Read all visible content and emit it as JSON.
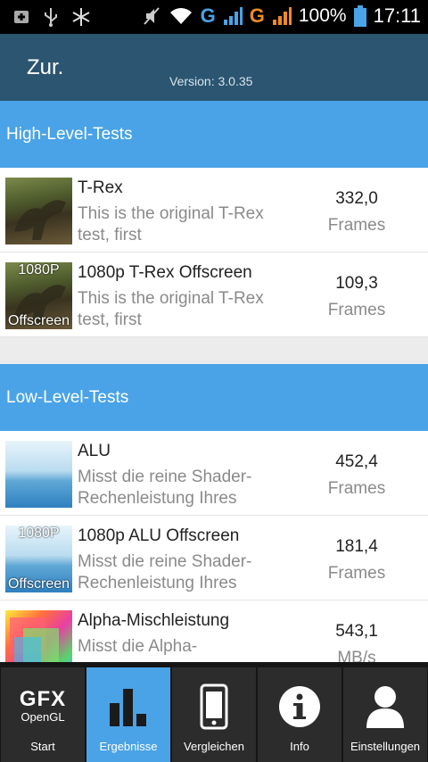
{
  "status_bar": {
    "battery": "100%",
    "time": "17:11",
    "network_1": "G",
    "network_2": "G",
    "icons": [
      "notification-icon",
      "usb-icon",
      "snowflake-icon",
      "mute-icon",
      "wifi-icon",
      "signal-icon",
      "signal-icon",
      "battery-icon"
    ]
  },
  "header": {
    "back_label": "Zur.",
    "version": "Version: 3.0.35"
  },
  "sections": [
    {
      "title": "High-Level-Tests",
      "items": [
        {
          "title": "T-Rex",
          "desc": "This is the original T-Rex test, first",
          "value": "332,0",
          "unit": "Frames",
          "thumb": "trex",
          "overlay_top": "",
          "overlay_bottom": ""
        },
        {
          "title": "1080p T-Rex Offscreen",
          "desc": "This is the original T-Rex test, first",
          "value": "109,3",
          "unit": "Frames",
          "thumb": "trex",
          "overlay_top": "1080P",
          "overlay_bottom": "Offscreen"
        }
      ]
    },
    {
      "title": "Low-Level-Tests",
      "items": [
        {
          "title": "ALU",
          "desc": "Misst die reine Shader-Rechenleistung Ihres",
          "value": "452,4",
          "unit": "Frames",
          "thumb": "alu",
          "overlay_top": "",
          "overlay_bottom": ""
        },
        {
          "title": "1080p ALU Offscreen",
          "desc": "Misst die reine Shader-Rechenleistung Ihres",
          "value": "181,4",
          "unit": "Frames",
          "thumb": "alu",
          "overlay_top": "1080P",
          "overlay_bottom": "Offscreen"
        },
        {
          "title": "Alpha-Mischleistung",
          "desc": "Misst die Alpha-",
          "value": "543,1",
          "unit": "MB/s",
          "thumb": "alpha",
          "overlay_top": "",
          "overlay_bottom": ""
        }
      ]
    }
  ],
  "bottom_nav": {
    "logo_big": "GFX",
    "logo_small": "OpenGL",
    "items": [
      {
        "label": "Start",
        "icon": "gfx-logo-icon",
        "active": false
      },
      {
        "label": "Ergebnisse",
        "icon": "bar-chart-icon",
        "active": true
      },
      {
        "label": "Vergleichen",
        "icon": "phone-icon",
        "active": false
      },
      {
        "label": "Info",
        "icon": "info-icon",
        "active": false
      },
      {
        "label": "Einstellungen",
        "icon": "user-icon",
        "active": false
      }
    ]
  }
}
